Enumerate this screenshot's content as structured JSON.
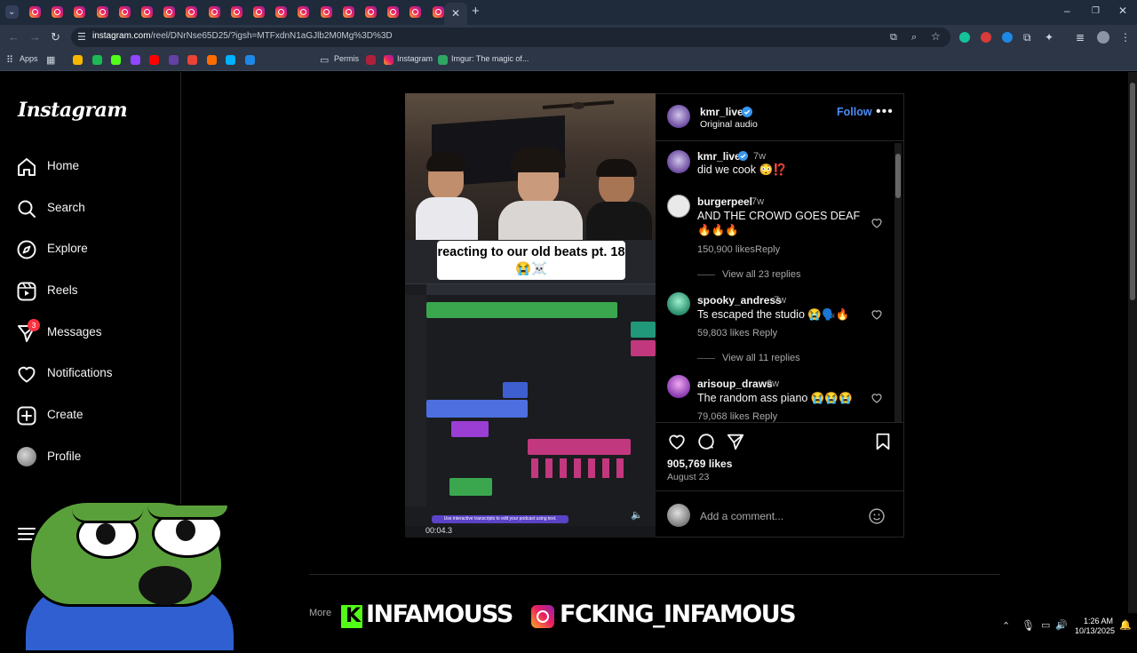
{
  "browser": {
    "address": {
      "domain": "instagram.com",
      "path": "/reel/DNrNse65D25/?igsh=MTFxdnN1aGJlb2M0Mg%3D%3D"
    },
    "bookmarks": [
      "Apps",
      "Permis",
      "Instagram",
      "Imgur: The magic of..."
    ]
  },
  "sidebar": {
    "logo": "Instagram",
    "items": [
      {
        "label": "Home"
      },
      {
        "label": "Search"
      },
      {
        "label": "Explore"
      },
      {
        "label": "Reels"
      },
      {
        "label": "Messages"
      },
      {
        "label": "Notifications"
      },
      {
        "label": "Create"
      },
      {
        "label": "Profile"
      }
    ],
    "messages_badge": "3"
  },
  "reel": {
    "caption": "reacting to our old beats pt. 18 😭☠️",
    "daw": {
      "time": "00:04.3",
      "banner": "Use interactive transcripts to edit your podcast using text."
    }
  },
  "post": {
    "author": "kmr_live",
    "audio": "Original audio",
    "follow_label": "Follow",
    "caption_comment": {
      "user": "kmr_live",
      "age": "7w",
      "text": "did we cook 😳⁉️"
    },
    "comments": [
      {
        "user": "burgerpeel",
        "age": "7w",
        "text": "AND THE CROWD GOES DEAF",
        "text2": "🔥🔥🔥",
        "likes": "150,900 likes",
        "reply": "Reply",
        "view_replies": "View all 23 replies"
      },
      {
        "user": "spooky_andress",
        "age": "7w",
        "text": "Ts escaped the studio 😭🗣️🔥",
        "likes": "59,803 likes",
        "reply": "Reply",
        "view_replies": "View all 11 replies"
      },
      {
        "user": "arisoup_draws",
        "age": "6w",
        "text": "The random ass piano 😭😭😭",
        "likes": "79,068 likes",
        "reply": "Reply"
      }
    ],
    "likes_total": "905,769 likes",
    "date": "August 23",
    "comment_placeholder": "Add a comment..."
  },
  "overlay": {
    "left_handle": "INFAMOUSS",
    "right_handle": "FCKING_INFAMOUS",
    "partial_text": "More"
  },
  "taskbar": {
    "time": "1:26 AM",
    "date": "10/13/2025"
  },
  "colors": {
    "follow_blue": "#4a8df8",
    "verified_blue": "#3897f0",
    "badge_red": "#ff3040",
    "kick_green": "#53fc18"
  }
}
